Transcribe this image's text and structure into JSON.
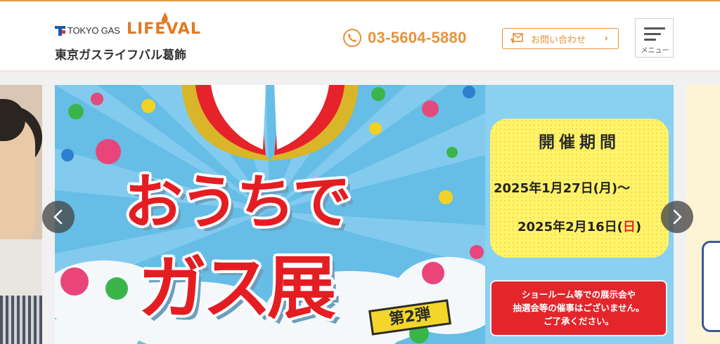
{
  "header": {
    "logo": {
      "brand_prefix": "TOKYO GAS",
      "brand_name": "LIFEVAL",
      "store_name": "東京ガスライフバル葛飾"
    },
    "phone": {
      "icon": "phone-icon",
      "number": "03-5604-5880"
    },
    "contact_button": {
      "icon": "contact-icon",
      "label": "お問い合わせ",
      "chevron": "›"
    },
    "menu_button": {
      "icon": "hamburger-icon",
      "label": "メニュー"
    }
  },
  "slider": {
    "active_slide": {
      "headline_line1": "おうちで",
      "headline_line2": "ガス展",
      "badge": "第2弾",
      "period": {
        "title": "開催期間",
        "start": "2025年1月27日(月)～",
        "end_prefix": "2025年2月16日(",
        "end_day": "日",
        "end_suffix": ")"
      },
      "notice": {
        "line1": "ショールーム等での展示会や",
        "line2": "抽選会等の催事はございません。",
        "line3": "ご了承ください。"
      }
    },
    "prev_arrow": "chevron-left-icon",
    "next_arrow": "chevron-right-icon"
  },
  "colors": {
    "accent_orange": "#e8913a",
    "brand_red": "#e41d22",
    "banner_blue": "#6fc3ea",
    "period_yellow": "#fff36a"
  }
}
